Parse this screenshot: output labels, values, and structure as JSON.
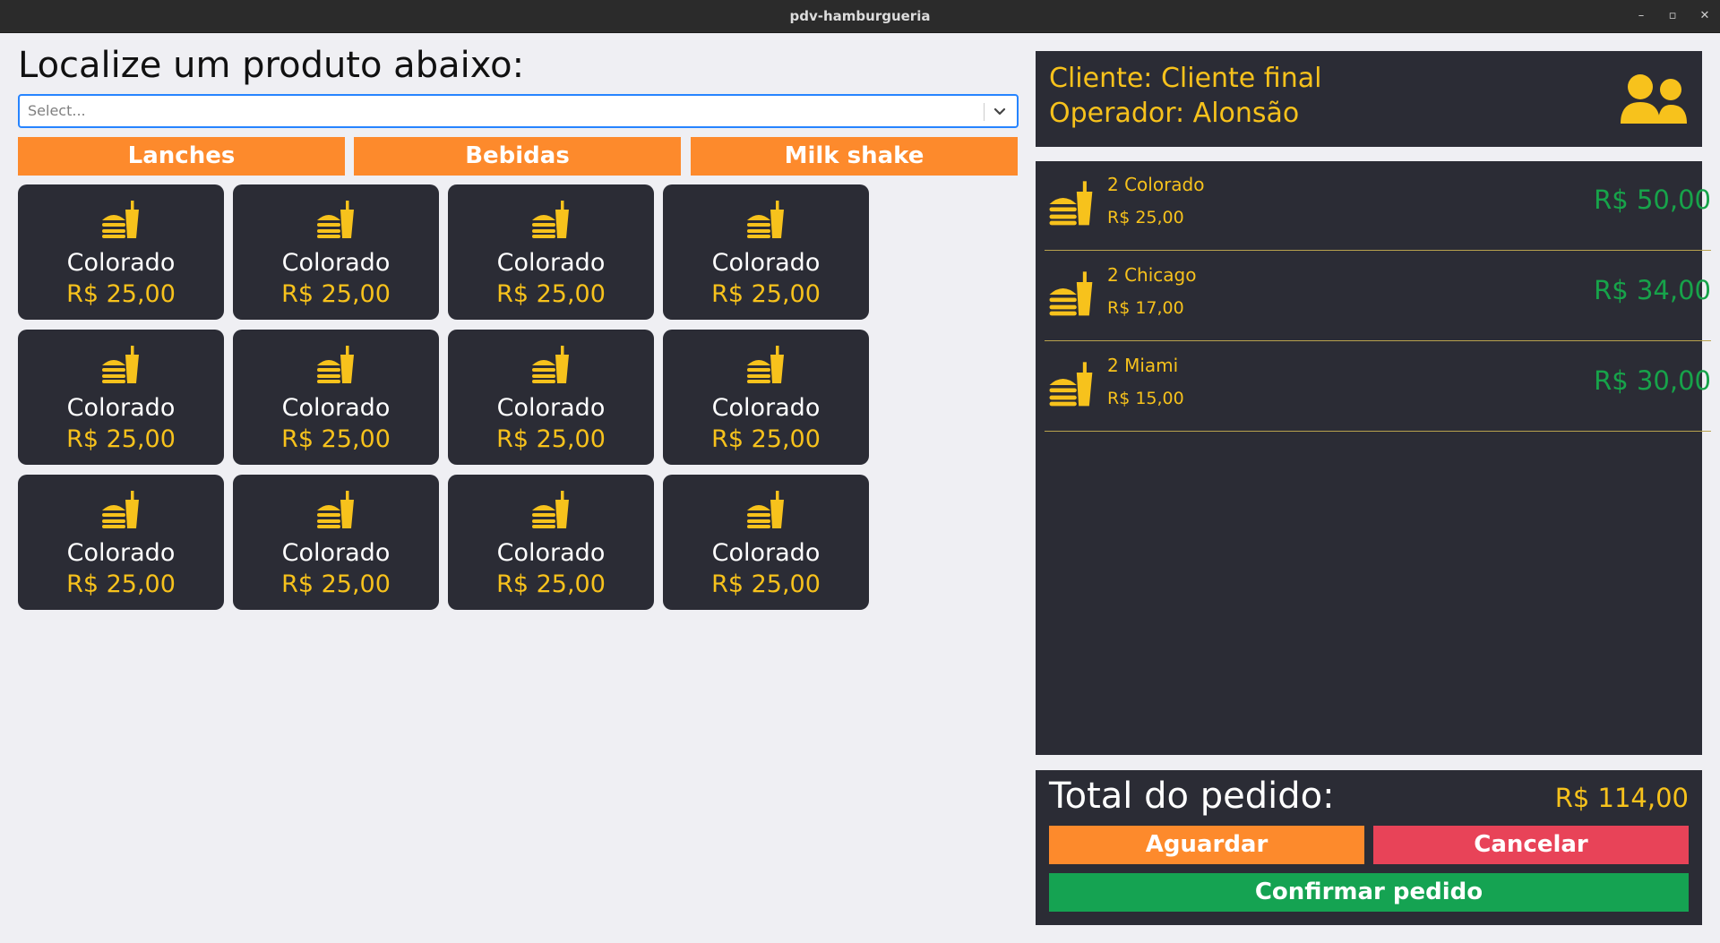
{
  "window": {
    "title": "pdv-hamburgueria",
    "minimize": "–",
    "restore": "▫",
    "close": "✕"
  },
  "search": {
    "heading": "Localize um produto abaixo:",
    "placeholder": "Select..."
  },
  "categories": [
    "Lanches",
    "Bebidas",
    "Milk shake"
  ],
  "products": [
    {
      "name": "Colorado",
      "price": "R$ 25,00",
      "icon": "burger-drink-icon"
    },
    {
      "name": "Colorado",
      "price": "R$ 25,00",
      "icon": "burger-drink-icon"
    },
    {
      "name": "Colorado",
      "price": "R$ 25,00",
      "icon": "burger-drink-icon"
    },
    {
      "name": "Colorado",
      "price": "R$ 25,00",
      "icon": "burger-drink-icon"
    },
    {
      "name": "Colorado",
      "price": "R$ 25,00",
      "icon": "burger-drink-icon"
    },
    {
      "name": "Colorado",
      "price": "R$ 25,00",
      "icon": "burger-drink-icon"
    },
    {
      "name": "Colorado",
      "price": "R$ 25,00",
      "icon": "burger-drink-icon"
    },
    {
      "name": "Colorado",
      "price": "R$ 25,00",
      "icon": "burger-drink-icon"
    },
    {
      "name": "Colorado",
      "price": "R$ 25,00",
      "icon": "burger-drink-icon"
    },
    {
      "name": "Colorado",
      "price": "R$ 25,00",
      "icon": "burger-drink-icon"
    },
    {
      "name": "Colorado",
      "price": "R$ 25,00",
      "icon": "burger-drink-icon"
    },
    {
      "name": "Colorado",
      "price": "R$ 25,00",
      "icon": "burger-drink-icon"
    }
  ],
  "client": {
    "customer": "Cliente: Cliente final",
    "operator": "Operador: Alonsão",
    "icon": "users-icon"
  },
  "order_items": [
    {
      "name": "2 Colorado",
      "unit_price": "R$ 25,00",
      "total": "R$ 50,00"
    },
    {
      "name": "2 Chicago",
      "unit_price": "R$ 17,00",
      "total": "R$ 34,00"
    },
    {
      "name": "2 Miami",
      "unit_price": "R$ 15,00",
      "total": "R$ 30,00"
    }
  ],
  "totals": {
    "label": "Total do pedido:",
    "value": "R$ 114,00"
  },
  "actions": {
    "wait": "Aguardar",
    "cancel": "Cancelar",
    "confirm": "Confirmar pedido"
  },
  "colors": {
    "accent_orange": "#fd8a2c",
    "danger": "#e84358",
    "success": "#15a352",
    "yellow": "#f7c21c",
    "panel": "#2b2c35"
  }
}
